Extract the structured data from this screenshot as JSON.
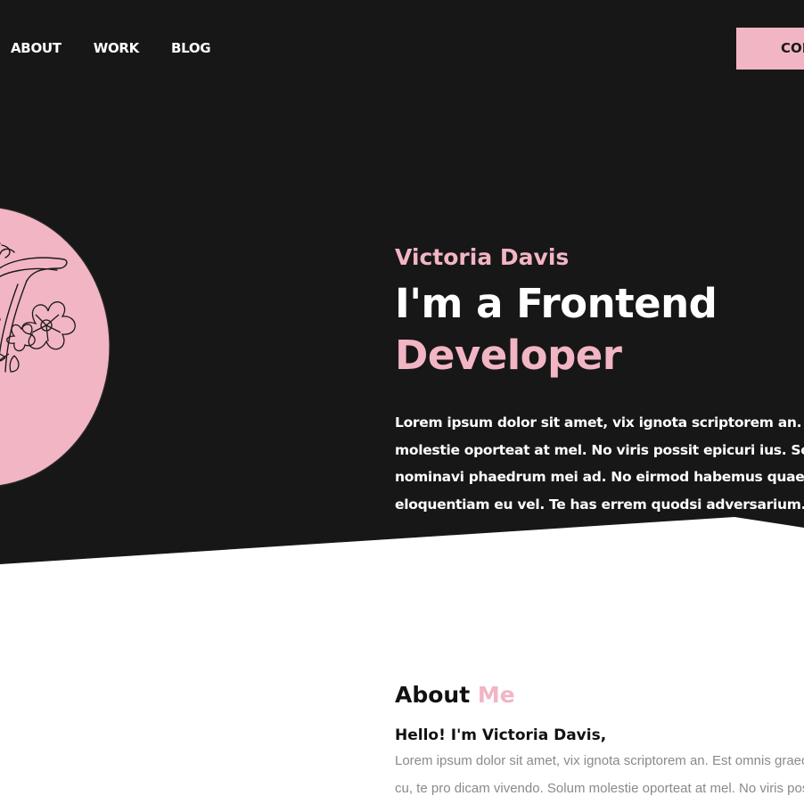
{
  "nav": {
    "items": [
      {
        "label": "ABOUT"
      },
      {
        "label": "WORK"
      },
      {
        "label": "BLOG"
      }
    ],
    "contact_label": "CONTACT"
  },
  "hero": {
    "name": "Victoria Davis",
    "title_line1": "I'm a Frontend",
    "title_line2": "Developer",
    "description_lines": [
      "Lorem ipsum dolor sit amet, vix ignota scriptorem an. Est omnis",
      "molestie oporteat at mel. No viris possit epicuri ius. Sea an",
      "nominavi phaedrum mei ad. No eirmod habemus quaerendum",
      "eloquentiam eu vel. Te has errem quodsi adversarium."
    ]
  },
  "about": {
    "heading_word1": "About",
    "heading_word2": "Me",
    "greeting": "Hello! I'm Victoria Davis,",
    "body_lines": [
      "Lorem ipsum dolor sit amet, vix ignota scriptorem an. Est omnis graeci",
      "cu, te pro dicam vivendo. Solum molestie oporteat at mel. No viris possit"
    ]
  },
  "colors": {
    "background_dark": "#171717",
    "accent_pink": "#f2b5c4",
    "text_light": "#ffffff",
    "text_muted": "#8a8a8a"
  },
  "icons": {
    "avatar": "monogram-v-floral-icon"
  }
}
